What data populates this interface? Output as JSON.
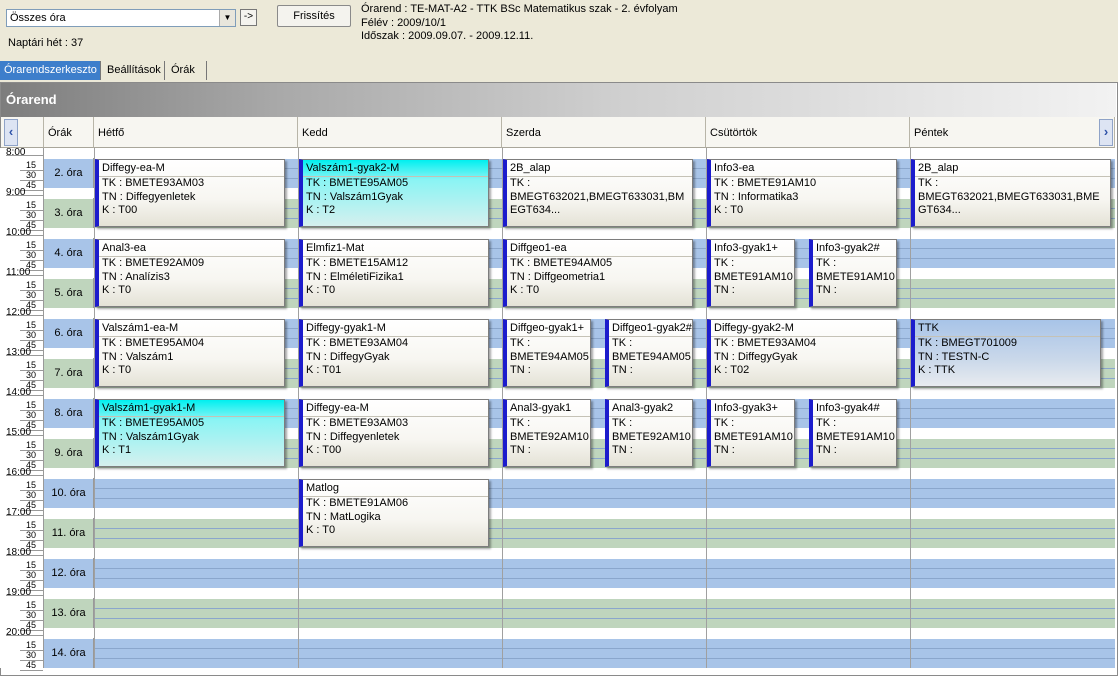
{
  "toolbar": {
    "group_select_value": "Összes óra",
    "go_label": "->",
    "refresh_label": "Frissítés",
    "info_line1": "Órarend : TE-MAT-A2 - TTK BSc Matematikus szak - 2. évfolyam",
    "info_line2": "Félév : 2009/10/1",
    "info_line3": "Időszak : 2009.09.07. - 2009.12.11.",
    "week_label": "Naptári hét : 37"
  },
  "tabs": [
    "Órarendszerkeszto",
    "Beállítások",
    "Órák"
  ],
  "panel": {
    "title": "Órarend",
    "col_time": "Órák",
    "days": [
      "Hétfő",
      "Kedd",
      "Szerda",
      "Csütörtök",
      "Péntek"
    ],
    "prev_icon": "‹",
    "next_icon": "›"
  },
  "hours": [
    "8:00",
    "9:00",
    "10:00",
    "11:00",
    "12:00",
    "13:00",
    "14:00",
    "15:00",
    "16:00",
    "17:00",
    "18:00",
    "19:00",
    "20:00"
  ],
  "quarters": [
    "15",
    "30",
    "45"
  ],
  "slots": [
    "2. óra",
    "3. óra",
    "4. óra",
    "5. óra",
    "6. óra",
    "7. óra",
    "8. óra",
    "9. óra",
    "10. óra",
    "11. óra",
    "12. óra",
    "13. óra",
    "14. óra"
  ],
  "events": {
    "mon1": {
      "title": "Diffegy-ea-M",
      "l1": "TK : BMETE93AM03",
      "l2": "TN : Diffegyenletek",
      "l3": "K : T00"
    },
    "tue1": {
      "title": "Valszám1-gyak2-M",
      "l1": "TK : BMETE95AM05",
      "l2": "TN : Valszám1Gyak",
      "l3": "K : T2"
    },
    "wed1": {
      "title": "2B_alap",
      "l1": "TK :",
      "l2": "BMEGT632021,BMEGT633031,BMEGT634..."
    },
    "thu1": {
      "title": "Info3-ea",
      "l1": "TK : BMETE91AM10",
      "l2": "TN : Informatika3",
      "l3": "K : T0"
    },
    "fri1": {
      "title": "2B_alap",
      "l1": "TK :",
      "l2": "BMEGT632021,BMEGT633031,BMEGT634..."
    },
    "mon2": {
      "title": "Anal3-ea",
      "l1": "TK : BMETE92AM09",
      "l2": "TN : Analízis3",
      "l3": "K : T0"
    },
    "tue2": {
      "title": "Elmfiz1-Mat",
      "l1": "TK : BMETE15AM12",
      "l2": "TN : ElméletiFizika1",
      "l3": "K : T0"
    },
    "wed2": {
      "title": "Diffgeo1-ea",
      "l1": "TK : BMETE94AM05",
      "l2": "TN : Diffgeometria1",
      "l3": "K : T0"
    },
    "thu2a": {
      "title": "Info3-gyak1+",
      "l1": "TK :",
      "l2": "BMETE91AM10",
      "l3": "TN :"
    },
    "thu2b": {
      "title": "Info3-gyak2#",
      "l1": "TK :",
      "l2": "BMETE91AM10",
      "l3": "TN :"
    },
    "mon3": {
      "title": "Valszám1-ea-M",
      "l1": "TK : BMETE95AM04",
      "l2": "TN : Valszám1",
      "l3": "K : T0"
    },
    "tue3": {
      "title": "Diffegy-gyak1-M",
      "l1": "TK : BMETE93AM04",
      "l2": "TN : DiffegyGyak",
      "l3": "K : T01"
    },
    "wed3a": {
      "title": "Diffgeo-gyak1+",
      "l1": "TK :",
      "l2": "BMETE94AM05",
      "l3": "TN :"
    },
    "wed3b": {
      "title": "Diffgeo1-gyak2#",
      "l1": "TK :",
      "l2": "BMETE94AM05",
      "l3": "TN :"
    },
    "thu3": {
      "title": "Diffegy-gyak2-M",
      "l1": "TK : BMETE93AM04",
      "l2": "TN : DiffegyGyak",
      "l3": "K : T02"
    },
    "fri3": {
      "title": "TTK",
      "l1": "TK : BMEGT701009",
      "l2": "TN : TESTN-C",
      "l3": "K : TTK"
    },
    "mon4": {
      "title": "Valszám1-gyak1-M",
      "l1": "TK : BMETE95AM05",
      "l2": "TN : Valszám1Gyak",
      "l3": "K : T1"
    },
    "tue4": {
      "title": "Diffegy-ea-M",
      "l1": "TK : BMETE93AM03",
      "l2": "TN : Diffegyenletek",
      "l3": "K : T00"
    },
    "wed4a": {
      "title": "Anal3-gyak1",
      "l1": "TK :",
      "l2": "BMETE92AM10",
      "l3": "TN :"
    },
    "wed4b": {
      "title": "Anal3-gyak2",
      "l1": "TK :",
      "l2": "BMETE92AM10",
      "l3": "TN :"
    },
    "thu4a": {
      "title": "Info3-gyak3+",
      "l1": "TK :",
      "l2": "BMETE91AM10",
      "l3": "TN :"
    },
    "thu4b": {
      "title": "Info3-gyak4#",
      "l1": "TK :",
      "l2": "BMETE91AM10",
      "l3": "TN :"
    },
    "tue5": {
      "title": "Matlog",
      "l1": "TK : BMETE91AM06",
      "l2": "TN : MatLogika",
      "l3": "K : T0"
    }
  }
}
